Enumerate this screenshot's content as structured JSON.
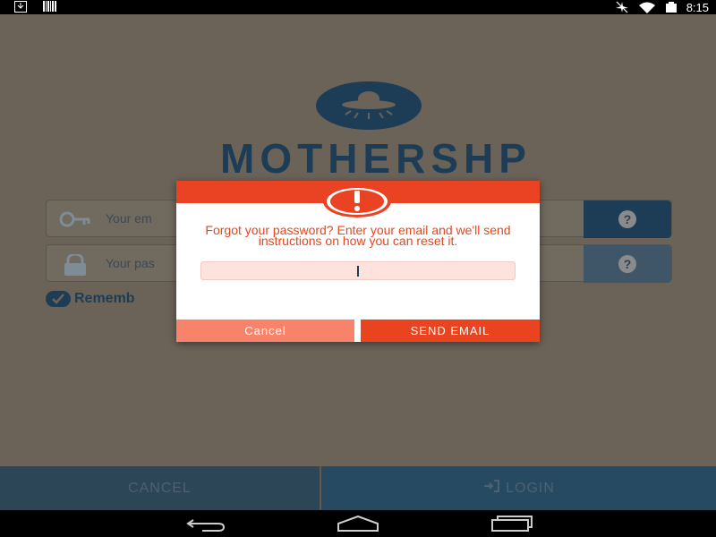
{
  "status": {
    "time": "8:15",
    "icons": [
      "download-icon",
      "barcode-icon",
      "airplane-off-icon",
      "wifi-icon",
      "battery-icon"
    ]
  },
  "app": {
    "brand": "MOTHERSHP",
    "email_placeholder": "Your em",
    "password_placeholder": "Your pas",
    "help": "?",
    "remember_label": "Rememb"
  },
  "dialog": {
    "message": "Forgot your password? Enter your email and we'll send instructions on how you can reset it.",
    "cancel_label": "Cancel",
    "send_label": "SEND EMAIL"
  },
  "bottom": {
    "cancel_label": "CANCEL",
    "login_label": "LOGIN"
  },
  "colors": {
    "background": "#6b6358",
    "brand": "#1d3d57",
    "dialog_accent": "#ea4323"
  }
}
